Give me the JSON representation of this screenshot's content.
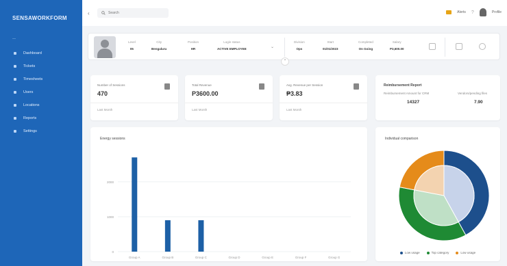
{
  "sidebar": {
    "brand": "SENSAWORKFORM",
    "sub": "—",
    "items": [
      {
        "label": "Dashboard"
      },
      {
        "label": "Tickets"
      },
      {
        "label": "Timesheets"
      },
      {
        "label": "Users"
      },
      {
        "label": "Locations"
      },
      {
        "label": "Reports"
      },
      {
        "label": "Settings"
      }
    ]
  },
  "topbar": {
    "search_placeholder": "Search",
    "notif_label": "Alerts",
    "user_label": "Profile"
  },
  "profile": {
    "fields": [
      {
        "label": "Level",
        "value": "05"
      },
      {
        "label": "City",
        "value": "Bengaluru"
      },
      {
        "label": "Position",
        "value": "HR"
      },
      {
        "label": "Login status",
        "value": "ACTIVE EMPLOYEE"
      },
      {
        "label": "Division",
        "value": "Ops"
      },
      {
        "label": "Start",
        "value": "01/01/2023"
      },
      {
        "label": "Completed",
        "value": "On Going"
      },
      {
        "label": "Salary",
        "value": "P3,600.00"
      }
    ]
  },
  "stats": [
    {
      "label": "Number of Sessions",
      "value": "470",
      "foot": "Last Month"
    },
    {
      "label": "Total Revenue",
      "value": "P3600.00",
      "foot": "Last Month"
    },
    {
      "label": "Avg. Revenue per Session",
      "value": "₱3.83",
      "foot": "Last Month"
    }
  ],
  "report": {
    "title": "Reimbursement Report",
    "col1_label": "Reimbursement Amount for CRM",
    "col1_value": "14327",
    "col2_label": "Vendors/pending files",
    "col2_value": "7.90"
  },
  "bar_card": {
    "title": "Energy sessions"
  },
  "donut_card": {
    "title": "Individual comparison"
  },
  "chart_data": [
    {
      "type": "bar",
      "title": "Energy sessions",
      "categories": [
        "Group A",
        "Group B",
        "Group C",
        "Group D",
        "Group E",
        "Group F",
        "Group G"
      ],
      "values": [
        2700,
        900,
        900,
        0,
        0,
        0,
        0
      ],
      "ylim": [
        0,
        2900
      ],
      "yticks": [
        "0",
        "1000",
        "2000",
        "3000"
      ],
      "color": "#1d60a6"
    },
    {
      "type": "pie",
      "title": "Individual comparison",
      "series": [
        {
          "name": "Low usage",
          "outer": [
            0.42,
            0.36,
            0.22
          ],
          "colors": [
            "#1d4f8c",
            "#1f8a34",
            "#e58b1a"
          ]
        },
        {
          "name": "Top category",
          "inner": [
            0.42,
            0.36,
            0.22
          ],
          "colors": [
            "#c7d3ea",
            "#bfe0c6",
            "#f3d3b0"
          ]
        }
      ],
      "legend": [
        "Low usage",
        "Top category",
        "Low usage"
      ],
      "legend_colors": [
        "#1d4f8c",
        "#1f8a34",
        "#e58b1a"
      ]
    }
  ]
}
